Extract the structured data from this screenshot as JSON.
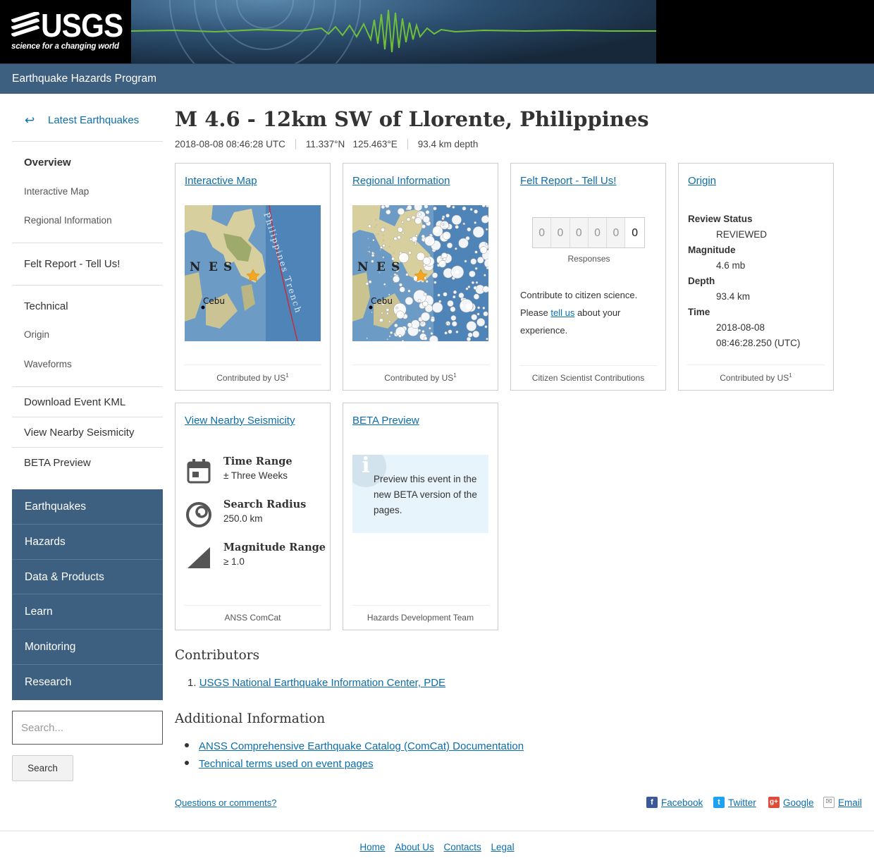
{
  "header": {
    "logo_text": "USGS",
    "logo_tagline": "science for a changing world",
    "program": "Earthquake Hazards Program"
  },
  "sidebar": {
    "back_label": "Latest Earthquakes",
    "back_arrow": "↩",
    "items": {
      "overview": "Overview",
      "interactive_map": "Interactive Map",
      "regional_information": "Regional Information",
      "felt_report": "Felt Report - Tell Us!",
      "technical": "Technical",
      "origin": "Origin",
      "waveforms": "Waveforms",
      "download_kml": "Download Event KML",
      "nearby_seismicity": "View Nearby Seismicity",
      "beta_preview": "BETA Preview"
    },
    "nav": [
      "Earthquakes",
      "Hazards",
      "Data & Products",
      "Learn",
      "Monitoring",
      "Research"
    ],
    "search_placeholder": "Search...",
    "search_button": "Search"
  },
  "event": {
    "title": "M 4.6 - 12km SW of Llorente, Philippines",
    "time": "2018-08-08 08:46:28 UTC",
    "coords": "11.337°N   125.463°E",
    "depth": "93.4 km depth"
  },
  "cards": {
    "interactive_map": {
      "title": "Interactive Map",
      "footer": "Contributed by US",
      "footer_sup": "1",
      "map_labels": {
        "n": "N",
        "e": "E",
        "s": "S",
        "city": "Cebu",
        "trench": "Philippines Trench"
      }
    },
    "regional": {
      "title": "Regional Information",
      "footer": "Contributed by US",
      "footer_sup": "1",
      "map_labels": {
        "n": "N",
        "e": "E",
        "s": "S",
        "city": "Cebu"
      }
    },
    "felt": {
      "title": "Felt Report - Tell Us!",
      "digits": [
        "0",
        "0",
        "0",
        "0",
        "0",
        "0"
      ],
      "responses_label": "Responses",
      "text_before": "Contribute to citizen science. Please ",
      "link": "tell us",
      "text_after": " about your experience.",
      "footer": "Citizen Scientist Contributions"
    },
    "origin": {
      "title": "Origin",
      "review_status_label": "Review Status",
      "review_status": "REVIEWED",
      "magnitude_label": "Magnitude",
      "magnitude": "4.6 mb",
      "depth_label": "Depth",
      "depth": "93.4 km",
      "time_label": "Time",
      "time_date": "2018-08-08",
      "time_clock": "08:46:28.250 (UTC)",
      "footer": "Contributed by US",
      "footer_sup": "1"
    },
    "seismicity": {
      "title": "View Nearby Seismicity",
      "time_range_label": "Time Range",
      "time_range": "± Three Weeks",
      "radius_label": "Search Radius",
      "radius": "250.0 km",
      "magnitude_label": "Magnitude Range",
      "magnitude": "≥ 1.0",
      "footer": "ANSS ComCat"
    },
    "beta": {
      "title": "BETA Preview",
      "info_glyph": "i",
      "text": "Preview this event in the new BETA version of the pages.",
      "footer": "Hazards Development Team"
    }
  },
  "contributors": {
    "heading": "Contributors",
    "number": "1.",
    "item": "USGS National Earthquake Information Center, PDE"
  },
  "additional": {
    "heading": "Additional Information",
    "links": [
      "ANSS Comprehensive Earthquake Catalog (ComCat) Documentation",
      "Technical terms used on event pages"
    ]
  },
  "bottom": {
    "questions": "Questions or comments?",
    "share": {
      "facebook": "Facebook",
      "twitter": "Twitter",
      "google": "Google",
      "email": "Email"
    }
  },
  "footer": {
    "links": [
      "Home",
      "About Us",
      "Contacts",
      "Legal"
    ]
  },
  "colors": {
    "nav_blue": "#3d5f80",
    "link": "#0b6ead",
    "beta_bg": "#e8f4fb"
  }
}
